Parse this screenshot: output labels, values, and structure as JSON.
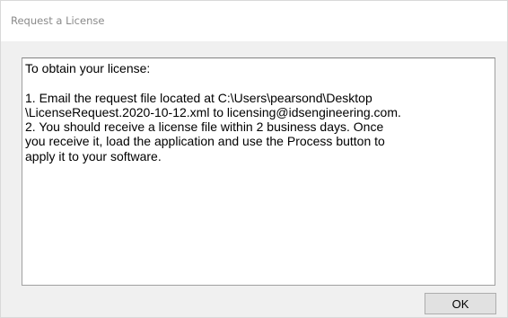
{
  "window": {
    "title": "Request a License"
  },
  "message": {
    "lines": [
      "To obtain your license:",
      "",
      "1. Email the request file located at C:\\Users\\pearsond\\Desktop",
      "\\LicenseRequest.2020-10-12.xml to licensing@idsengineering.com.",
      "2. You should receive a license file within 2 business days. Once",
      "you receive it, load the application and use the Process button to",
      "apply it to your software."
    ]
  },
  "buttons": {
    "ok_label": "OK"
  },
  "colors": {
    "dialog_background": "#f0f0f0",
    "title_text": "#8a8a8a",
    "button_face": "#e1e1e1",
    "button_border": "#adadad"
  }
}
